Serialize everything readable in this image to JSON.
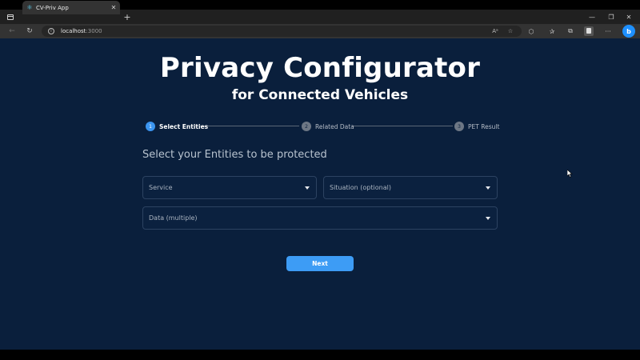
{
  "browser": {
    "tab": {
      "title": "CV-Priv App",
      "favicon": "react-icon",
      "close_glyph": "✕"
    },
    "new_tab_glyph": "+",
    "window_controls": {
      "minimize": "—",
      "maximize": "❐",
      "close": "✕"
    },
    "address": {
      "host": "localhost",
      "port": ":3000"
    },
    "nav": {
      "back": "←",
      "refresh": "↻"
    },
    "toolbar_icons": [
      "read-aloud-icon",
      "add-favorite-icon",
      "extensions-icon",
      "favorites-icon",
      "collections-icon",
      "profile-icon",
      "more-icon",
      "bing-icon"
    ],
    "toolbar_glyphs": {
      "read_aloud": "Aᵃ",
      "add_favorite": "☆",
      "extensions": "⬡",
      "favorites": "✰",
      "collections": "⧉",
      "more": "···",
      "bing": "b"
    }
  },
  "app": {
    "title": "Privacy Configurator",
    "subtitle": "for Connected Vehicles",
    "stepper": [
      {
        "number": "1",
        "label": "Select Entities",
        "active": true
      },
      {
        "number": "2",
        "label": "Related Data",
        "active": false
      },
      {
        "number": "3",
        "label": "PET Result",
        "active": false
      }
    ],
    "section_heading": "Select your Entities to be protected",
    "fields": {
      "service": "Service",
      "situation": "Situation (optional)",
      "data": "Data (multiple)"
    },
    "next_label": "Next"
  },
  "colors": {
    "page_bg": "#0a1f3c",
    "accent": "#3d9cf5",
    "field_border": "#2c4261"
  }
}
